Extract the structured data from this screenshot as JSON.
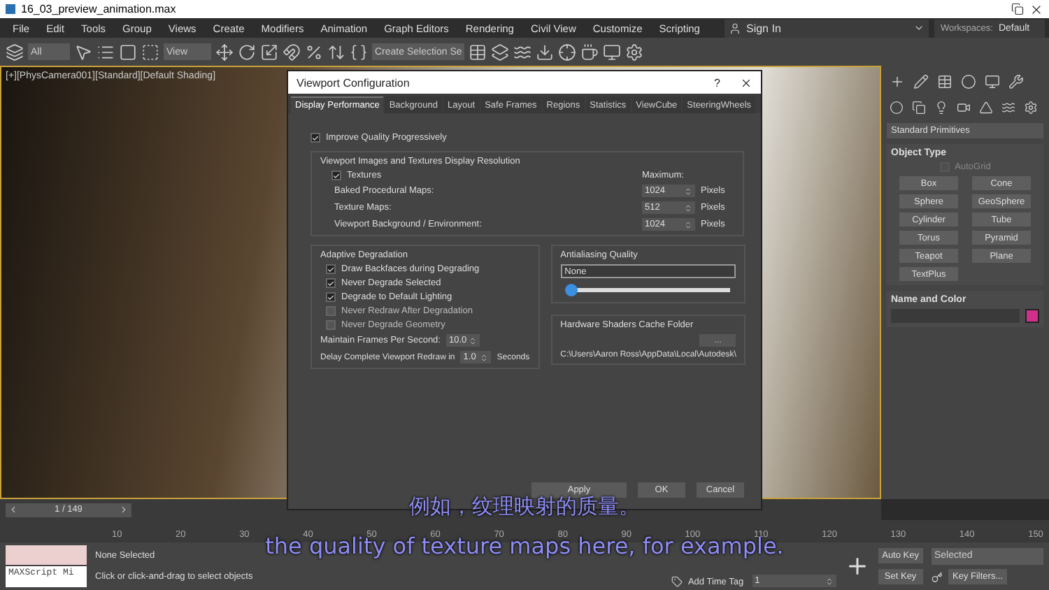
{
  "window": {
    "title": "16_03_preview_animation.max"
  },
  "menu": [
    "File",
    "Edit",
    "Tools",
    "Group",
    "Views",
    "Create",
    "Modifiers",
    "Animation",
    "Graph Editors",
    "Rendering",
    "Civil View",
    "Customize",
    "Scripting"
  ],
  "account": {
    "label": "Sign In"
  },
  "workspaces": {
    "label": "Workspaces:",
    "value": "Default"
  },
  "toolbar": {
    "filter": "All",
    "ref_coord": "View",
    "selection_set": "Create Selection Se"
  },
  "viewport": {
    "label": "[+][PhysCamera001][Standard][Default Shading]"
  },
  "dialog": {
    "title": "Viewport Configuration",
    "help": "?",
    "tabs": [
      {
        "label": "Display Performance",
        "selected": true
      },
      {
        "label": "Background",
        "selected": false
      },
      {
        "label": "Layout",
        "selected": false
      },
      {
        "label": "Safe Frames",
        "selected": false
      },
      {
        "label": "Regions",
        "selected": false
      },
      {
        "label": "Statistics",
        "selected": false
      },
      {
        "label": "ViewCube",
        "selected": false
      },
      {
        "label": "SteeringWheels",
        "selected": false
      }
    ],
    "improve": {
      "label": "Improve Quality Progressively",
      "checked": true
    },
    "resolution": {
      "title": "Viewport Images and Textures Display Resolution",
      "textures": {
        "label": "Textures",
        "checked": true
      },
      "max_label": "Maximum:",
      "rows": [
        {
          "label": "Baked Procedural Maps:",
          "value": "1024",
          "unit": "Pixels"
        },
        {
          "label": "Texture Maps:",
          "value": "512",
          "unit": "Pixels"
        },
        {
          "label": "Viewport Background / Environment:",
          "value": "1024",
          "unit": "Pixels"
        }
      ]
    },
    "adaptive": {
      "title": "Adaptive Degradation",
      "options": [
        {
          "label": "Draw Backfaces during Degrading",
          "checked": true
        },
        {
          "label": "Never Degrade Selected",
          "checked": true
        },
        {
          "label": "Degrade to Default Lighting",
          "checked": true
        },
        {
          "label": "Never Redraw After Degradation",
          "checked": false
        },
        {
          "label": "Never Degrade Geometry",
          "checked": false
        }
      ],
      "fps": {
        "label": "Maintain Frames Per Second:",
        "value": "10.0"
      },
      "delay": {
        "label": "Delay Complete Viewport Redraw in",
        "value": "1.0",
        "unit": "Seconds"
      }
    },
    "antialiasing": {
      "title": "Antialiasing Quality",
      "value": "None",
      "level": 0.03
    },
    "cache": {
      "title": "Hardware Shaders Cache Folder",
      "button": "...",
      "path": "C:\\Users\\Aaron Ross\\AppData\\Local\\Autodesk\\"
    },
    "buttons": [
      "Apply",
      "OK",
      "Cancel"
    ]
  },
  "command_panel": {
    "dropdown": "Standard Primitives",
    "object_type": {
      "title": "Object Type",
      "autogrid": {
        "label": "AutoGrid",
        "checked": false
      },
      "buttons": [
        "Box",
        "Cone",
        "Sphere",
        "GeoSphere",
        "Cylinder",
        "Tube",
        "Torus",
        "Pyramid",
        "Teapot",
        "Plane",
        "TextPlus"
      ]
    },
    "name_color": {
      "title": "Name and Color",
      "color": "#d0308a"
    }
  },
  "timeline": {
    "frame": "1 / 149",
    "ticks": [
      "10",
      "20",
      "30",
      "40",
      "50",
      "60",
      "70",
      "80",
      "90",
      "100",
      "110",
      "120",
      "130",
      "140",
      "150"
    ]
  },
  "status": {
    "maxscript": "MAXScript Mi",
    "selection": "None Selected",
    "prompt": "Click or click-and-drag to select objects",
    "add_time_tag": "Add Time Tag",
    "frame": "1",
    "auto_key": "Auto Key",
    "set_key": "Set Key",
    "key_mode": "Selected",
    "key_filters": "Key Filters..."
  },
  "subtitles": [
    "例如，纹理映射的质量。",
    "the quality of texture maps here, for example."
  ]
}
